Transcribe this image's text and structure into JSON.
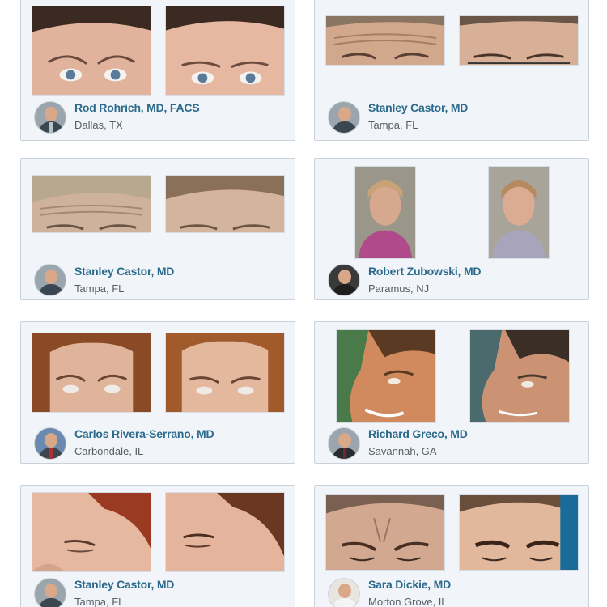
{
  "cards": [
    {
      "doctor": {
        "name": "Rod Rohrich, MD, FACS",
        "location": "Dallas, TX"
      }
    },
    {
      "doctor": {
        "name": "Stanley Castor, MD",
        "location": "Tampa, FL"
      }
    },
    {
      "doctor": {
        "name": "Stanley Castor, MD",
        "location": "Tampa, FL"
      }
    },
    {
      "doctor": {
        "name": "Robert Zubowski, MD",
        "location": "Paramus, NJ"
      }
    },
    {
      "doctor": {
        "name": "Carlos Rivera-Serrano, MD",
        "location": "Carbondale, IL"
      }
    },
    {
      "doctor": {
        "name": "Richard Greco, MD",
        "location": "Savannah, GA"
      }
    },
    {
      "doctor": {
        "name": "Stanley Castor, MD",
        "location": "Tampa, FL"
      }
    },
    {
      "doctor": {
        "name": "Sara Dickie, MD",
        "location": "Morton Grove, IL"
      }
    }
  ],
  "colors": {
    "card_background": "#f1f5f9",
    "card_border": "#c9d2db",
    "doctor_name": "#2b6a8c",
    "location_text": "#555e66"
  }
}
